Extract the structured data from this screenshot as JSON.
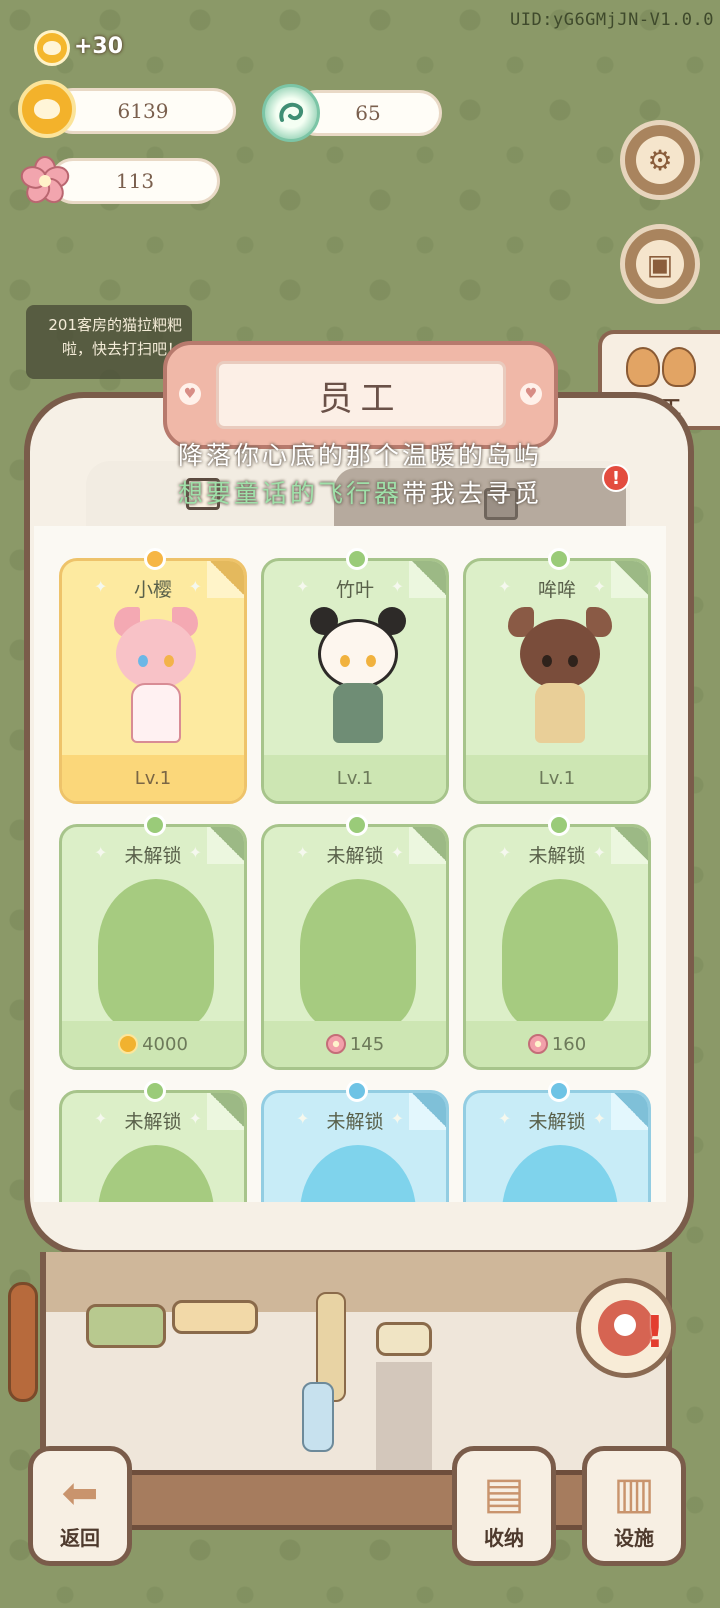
{
  "header": {
    "uid": "UID:yG6GMjJN-V1.0.0",
    "bonus": "+30"
  },
  "resources": {
    "coins": "6139",
    "dragon": "65",
    "sakura": "113"
  },
  "notice": {
    "text": "201客房的猫拉粑粑啦，快去打扫吧！"
  },
  "side_tab": {
    "label": "员工"
  },
  "panel": {
    "title": "员工",
    "lyric_line1": "降落你心底的那个温暖的岛屿",
    "lyric_line2_a": "想要童话的飞行器",
    "lyric_line2_b": "带我去寻觅",
    "alert": "!"
  },
  "cards": [
    {
      "name": "小樱",
      "footer": "Lv.1",
      "style": "gold"
    },
    {
      "name": "竹叶",
      "footer": "Lv.1",
      "style": "green"
    },
    {
      "name": "哞哞",
      "footer": "Lv.1",
      "style": "green"
    },
    {
      "name": "未解锁",
      "footer": "4000",
      "cost_icon": "coin-icon",
      "style": "green"
    },
    {
      "name": "未解锁",
      "footer": "145",
      "cost_icon": "sakura-icon",
      "style": "green"
    },
    {
      "name": "未解锁",
      "footer": "160",
      "cost_icon": "sakura-icon",
      "style": "green"
    },
    {
      "name": "未解锁",
      "footer": "",
      "style": "green"
    },
    {
      "name": "未解锁",
      "footer": "",
      "style": "blue"
    },
    {
      "name": "未解锁",
      "footer": "",
      "style": "blue"
    }
  ],
  "bottom": {
    "back": "返回",
    "storage": "收纳",
    "facilities": "设施"
  },
  "colors": {
    "background": "#8b9968",
    "panel": "#f6f0e6",
    "card_green": "#dcefc8",
    "card_gold": "#fdeaa0",
    "card_blue": "#c8ecf7",
    "title_plate": "#f0b8a8"
  }
}
